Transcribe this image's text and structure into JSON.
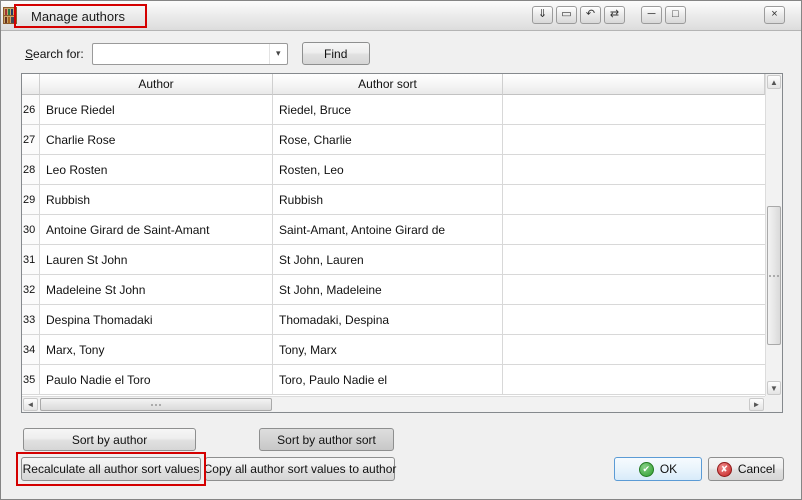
{
  "window": {
    "title": "Manage authors",
    "controls": [
      {
        "name": "keep-above",
        "glyph": "⇓"
      },
      {
        "name": "shade",
        "glyph": "▭"
      },
      {
        "name": "undo",
        "glyph": "↶"
      },
      {
        "name": "move",
        "glyph": "⇄"
      },
      {
        "name": "minimize",
        "glyph": "─"
      },
      {
        "name": "maximize",
        "glyph": "□"
      },
      {
        "name": "close",
        "glyph": "×"
      }
    ]
  },
  "search": {
    "label": "Search for:",
    "value": "",
    "find_label": "Find"
  },
  "table": {
    "headers": {
      "author": "Author",
      "author_sort": "Author sort",
      "extra": ""
    },
    "rows": [
      {
        "num": "26",
        "author": "Bruce Riedel",
        "author_sort": "Riedel, Bruce"
      },
      {
        "num": "27",
        "author": "Charlie Rose",
        "author_sort": "Rose, Charlie"
      },
      {
        "num": "28",
        "author": "Leo Rosten",
        "author_sort": "Rosten, Leo"
      },
      {
        "num": "29",
        "author": "Rubbish",
        "author_sort": "Rubbish"
      },
      {
        "num": "30",
        "author": "Antoine Girard de Saint-Amant",
        "author_sort": "Saint-Amant, Antoine Girard de"
      },
      {
        "num": "31",
        "author": "Lauren St John",
        "author_sort": "St John, Lauren"
      },
      {
        "num": "32",
        "author": "Madeleine St John",
        "author_sort": "St John, Madeleine"
      },
      {
        "num": "33",
        "author": "Despina Thomadaki",
        "author_sort": "Thomadaki, Despina"
      },
      {
        "num": "34",
        "author": "Marx, Tony",
        "author_sort": "Tony, Marx"
      },
      {
        "num": "35",
        "author": "Paulo Nadie el Toro",
        "author_sort": "Toro, Paulo Nadie el"
      }
    ]
  },
  "actions": {
    "sort_by_author": "Sort by author",
    "sort_by_author_sort": "Sort by author sort",
    "recalculate": "Recalculate all author sort values",
    "copy": "Copy all author sort values to author",
    "ok": "OK",
    "cancel": "Cancel"
  },
  "icons": {
    "combo_arrow": "▾",
    "ok_check": "✔",
    "cancel_cross": "✘",
    "scroll_up": "▲",
    "scroll_down": "▼",
    "scroll_left": "◄",
    "scroll_right": "►"
  },
  "annotations": {
    "color": "#d40000"
  }
}
